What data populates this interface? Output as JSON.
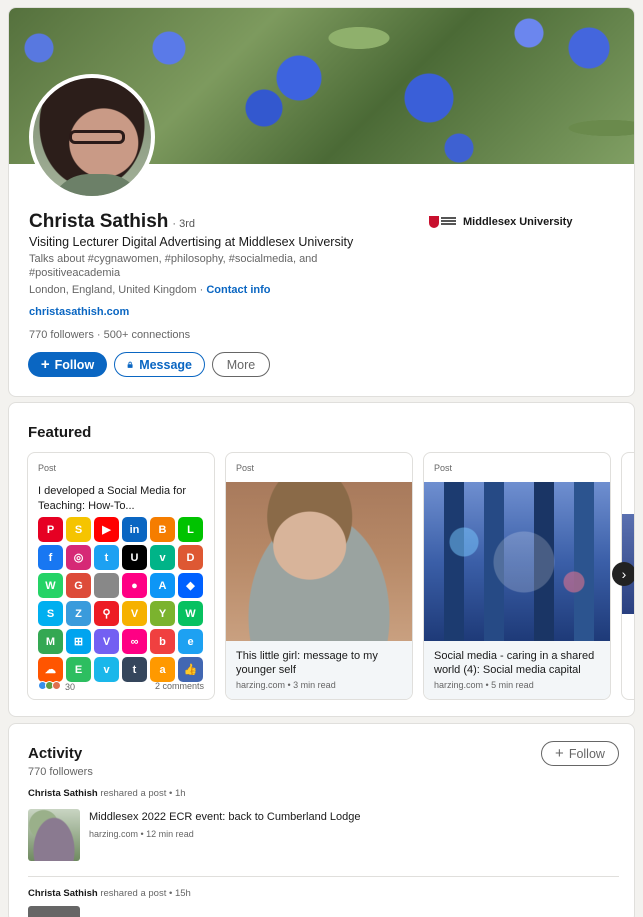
{
  "profile": {
    "name": "Christa Sathish",
    "degree": "· 3rd",
    "headline": "Visiting Lecturer Digital Advertising at Middlesex University",
    "talks_about": "Talks about #cygnawomen, #philosophy, #socialmedia, and #positiveacademia",
    "location": "London, England, United Kingdom",
    "location_sep": " · ",
    "contact_info": "Contact info",
    "website": "christasathish.com",
    "followers": "770 followers",
    "stats_sep": " · ",
    "connections": "500+ connections",
    "follow_label": "Follow",
    "message_label": "Message",
    "more_label": "More",
    "university": "Middlesex University"
  },
  "featured": {
    "title": "Featured",
    "items": [
      {
        "type": "Post",
        "body": "I developed a Social Media for Teaching: How-To...",
        "reactions": "30",
        "comments": "2 comments"
      },
      {
        "type": "Post",
        "title": "This little girl: message to my younger self",
        "meta": "harzing.com • 3 min read"
      },
      {
        "type": "Post",
        "title": "Social media - caring in a shared world (4): Social media capital",
        "meta": "harzing.com • 5 min read"
      }
    ],
    "apps": [
      {
        "g": "P",
        "c": "#e60023"
      },
      {
        "g": "S",
        "c": "#f5c400"
      },
      {
        "g": "▶",
        "c": "#ff0000"
      },
      {
        "g": "in",
        "c": "#0a66c2"
      },
      {
        "g": "B",
        "c": "#f57d00"
      },
      {
        "g": "L",
        "c": "#00c300"
      },
      {
        "g": "f",
        "c": "#1877f2"
      },
      {
        "g": "◎",
        "c": "#d62976"
      },
      {
        "g": "t",
        "c": "#1da1f2"
      },
      {
        "g": "U",
        "c": "#000000"
      },
      {
        "g": "v",
        "c": "#00b488"
      },
      {
        "g": "D",
        "c": "#de5833"
      },
      {
        "g": "W",
        "c": "#25d366"
      },
      {
        "g": "G",
        "c": "#dd4b39"
      },
      {
        "g": "",
        "c": "#888888"
      },
      {
        "g": "●",
        "c": "#ff0084"
      },
      {
        "g": "A",
        "c": "#0d96f6"
      },
      {
        "g": "◆",
        "c": "#0061ff"
      },
      {
        "g": "S",
        "c": "#00aff0"
      },
      {
        "g": "Z",
        "c": "#3a9bdc"
      },
      {
        "g": "⚲",
        "c": "#ed1c24"
      },
      {
        "g": "V",
        "c": "#f6b100"
      },
      {
        "g": "Y",
        "c": "#7bb32e"
      },
      {
        "g": "W",
        "c": "#07c160"
      },
      {
        "g": "M",
        "c": "#34a853"
      },
      {
        "g": "⊞",
        "c": "#00a4ef"
      },
      {
        "g": "V",
        "c": "#7360f2"
      },
      {
        "g": "∞",
        "c": "#ff0084"
      },
      {
        "g": "b",
        "c": "#f04040"
      },
      {
        "g": "e",
        "c": "#1da1f2"
      },
      {
        "g": "☁",
        "c": "#ff5500"
      },
      {
        "g": "E",
        "c": "#2dbe60"
      },
      {
        "g": "v",
        "c": "#1ab7ea"
      },
      {
        "g": "t",
        "c": "#35465c"
      },
      {
        "g": "a",
        "c": "#ff9900"
      },
      {
        "g": "👍",
        "c": "#4267b2"
      }
    ]
  },
  "activity": {
    "title": "Activity",
    "followers": "770 followers",
    "follow_label": "Follow",
    "posts": [
      {
        "actor": "Christa Sathish",
        "action": " reshared a post • 1h",
        "title": "Middlesex 2022 ECR event: back to Cumberland Lodge",
        "meta": "harzing.com • 12 min read"
      },
      {
        "actor": "Christa Sathish",
        "action": " reshared a post • 15h"
      }
    ]
  },
  "colors": {
    "accent": "#0a66c2",
    "background": "#f3f2ef"
  }
}
